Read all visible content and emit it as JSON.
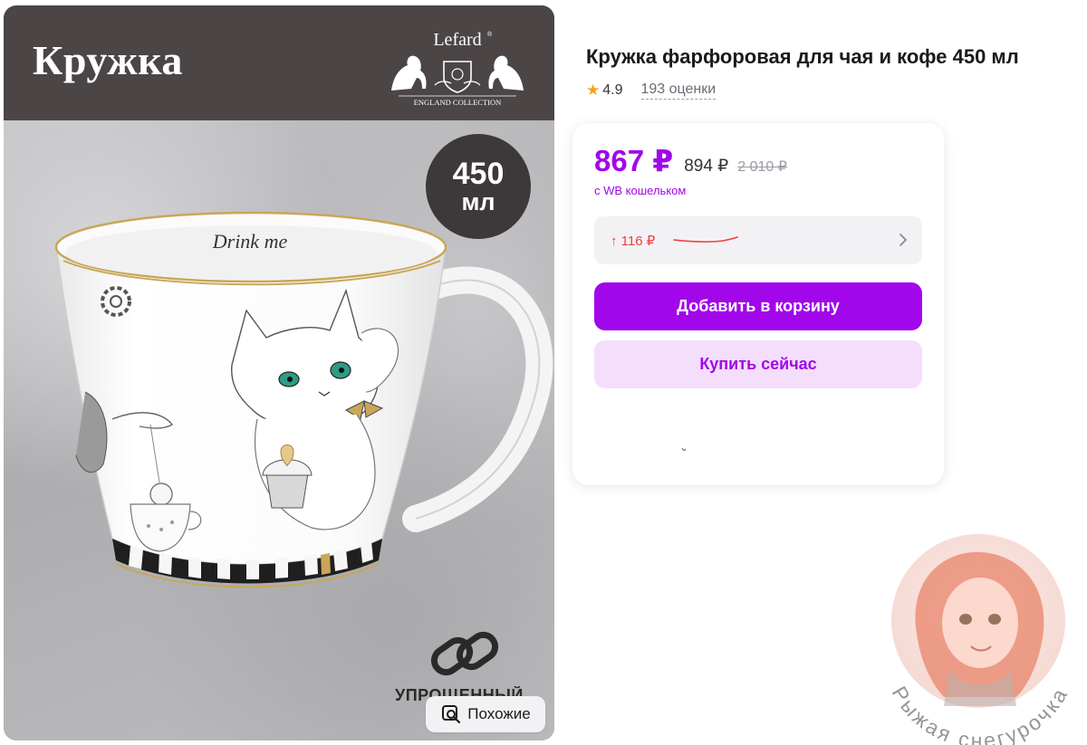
{
  "image": {
    "header_title": "Кружка",
    "brand": {
      "name": "Lefard",
      "tagline": "ENGLAND COLLECTION"
    },
    "mug_text": "Drink me",
    "volume_badge": {
      "value": "450",
      "unit": "мл"
    },
    "simplified_label": "УПРОЩЕННЫЙ",
    "similar_button": "Похожие"
  },
  "product": {
    "title": "Кружка фарфоровая для чая и кофе 450 мл",
    "rating": "4.9",
    "reviews": "193 оценки"
  },
  "price": {
    "current": "867 ₽",
    "old": "894 ₽",
    "original": "2 010 ₽",
    "wallet_note": "с WB кошельком",
    "history_delta": "↑ 116 ₽"
  },
  "actions": {
    "add_to_cart": "Добавить в корзину",
    "buy_now": "Купить сейчас"
  },
  "watermark_text": "Рыжая снегурочка",
  "colors": {
    "accent": "#a107ea",
    "accent_light": "#f4defc",
    "price_up": "#f23c3c",
    "star": "#f4a21e",
    "header_dark": "#4b4546"
  },
  "icons": [
    "star-icon",
    "chevron-right-icon",
    "similar-search-icon",
    "link-icon"
  ]
}
